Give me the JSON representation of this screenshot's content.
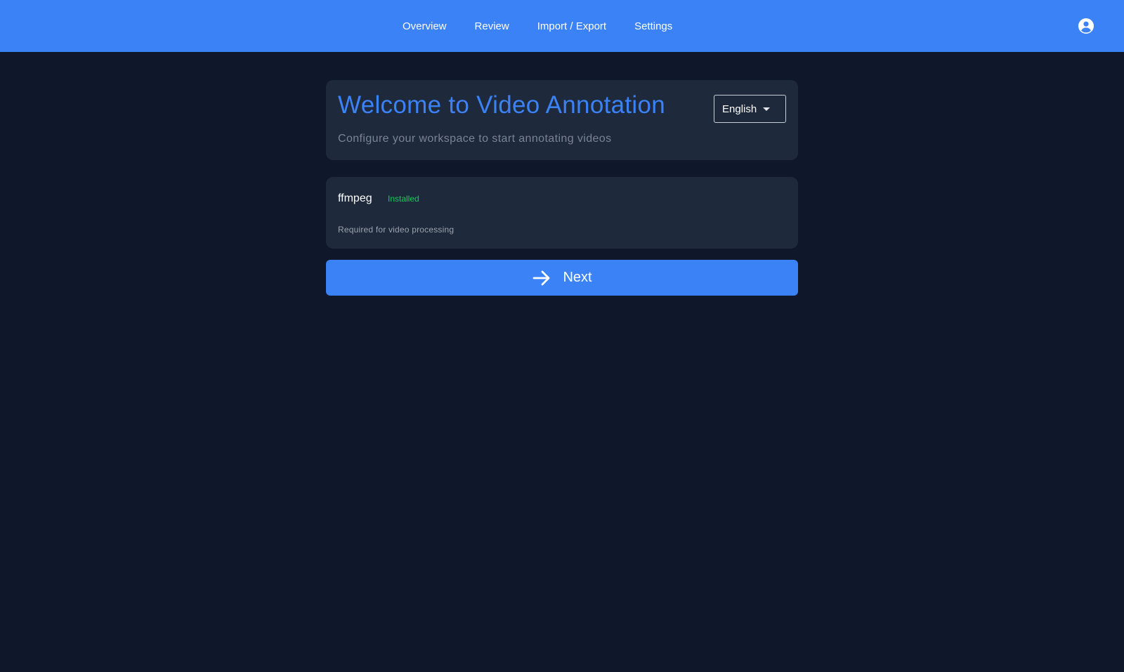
{
  "nav": {
    "items": [
      {
        "label": "Overview"
      },
      {
        "label": "Review"
      },
      {
        "label": "Import / Export"
      },
      {
        "label": "Settings"
      }
    ],
    "user_icon": "account-circle-icon"
  },
  "welcome": {
    "title": "Welcome to Video Annotation",
    "subtitle": "Configure your workspace to start annotating videos",
    "language": {
      "selected": "English",
      "icon": "chevron-down-icon"
    }
  },
  "dependency": {
    "name": "ffmpeg",
    "status": "Installed",
    "description": "Required for video processing"
  },
  "next_button": {
    "label": "Next",
    "icon": "arrow-right-icon"
  },
  "colors": {
    "accent": "#3b82f6",
    "background": "#0f172a",
    "card": "#1e293b",
    "success": "#22c55e"
  }
}
